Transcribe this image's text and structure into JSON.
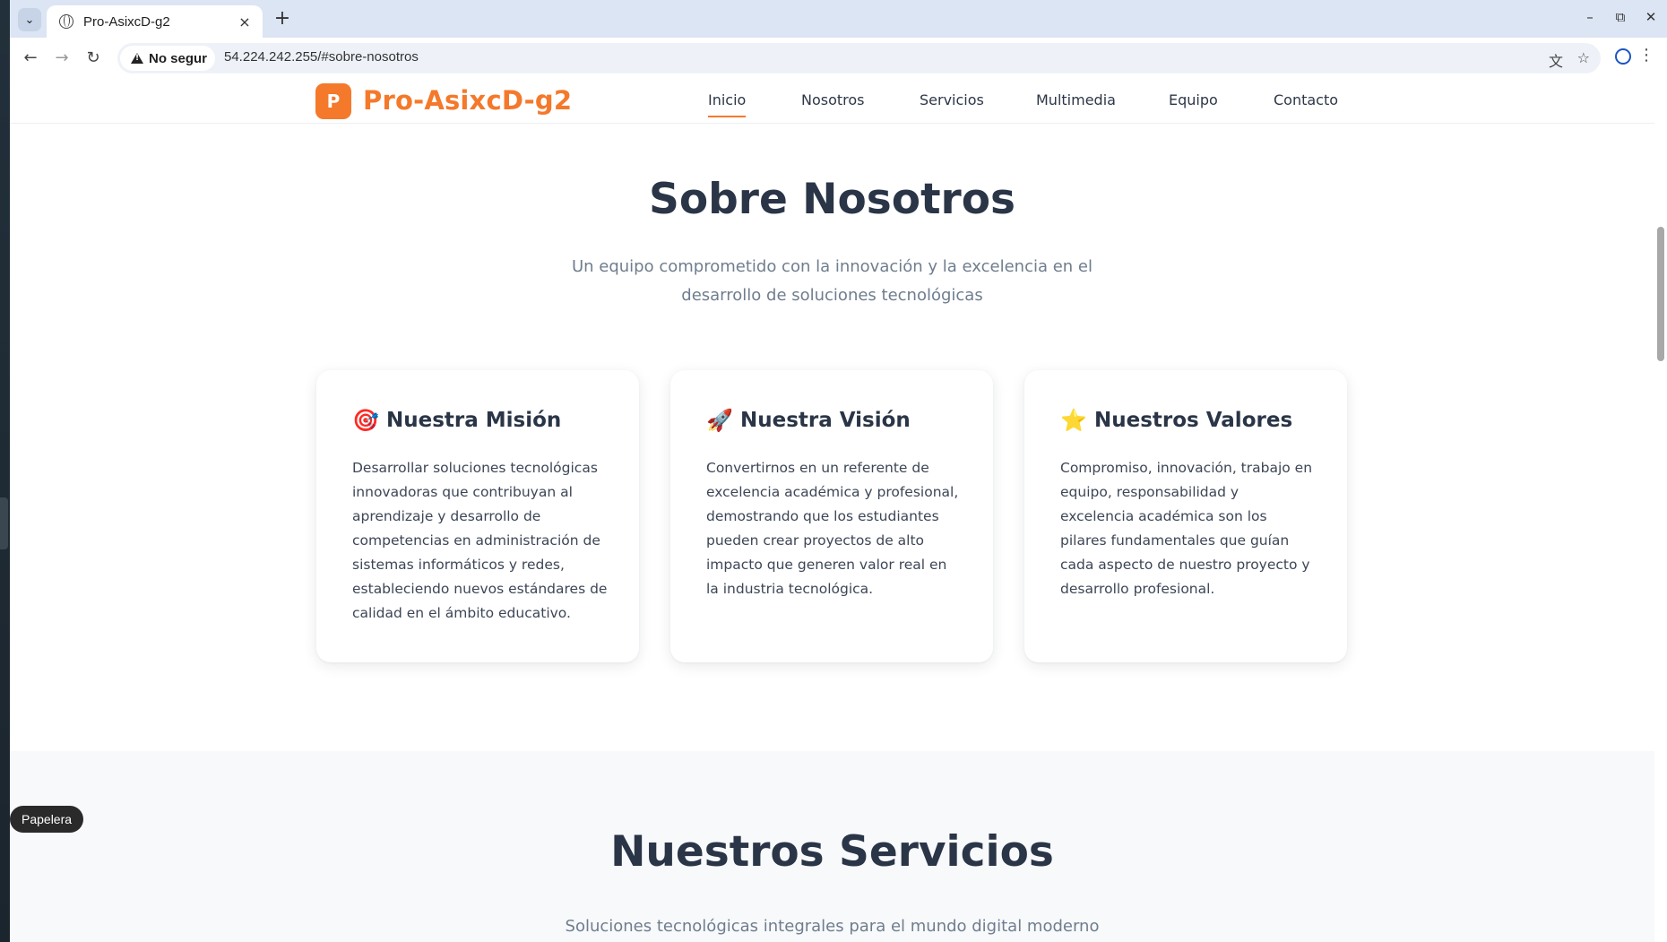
{
  "browser": {
    "tab_title": "Pro-AsixcD-g2",
    "tab_close": "×",
    "new_tab": "+",
    "security_label": "No segur",
    "url": "54.224.242.255/#sobre-nosotros"
  },
  "site": {
    "logo_letter": "P",
    "brand": "Pro-AsixcD-g2",
    "nav": [
      "Inicio",
      "Nosotros",
      "Servicios",
      "Multimedia",
      "Equipo",
      "Contacto"
    ],
    "active_nav": "Inicio"
  },
  "about": {
    "title": "Sobre Nosotros",
    "subtitle_line1": "Un equipo comprometido con la innovación y la excelencia en el",
    "subtitle_line2": "desarrollo de soluciones tecnológicas",
    "cards": [
      {
        "icon": "🎯",
        "title": "Nuestra Misión",
        "text": "Desarrollar soluciones tecnológicas innovadoras que contribuyan al aprendizaje y desarrollo de competencias en administración de sistemas informáticos y redes, estableciendo nuevos estándares de calidad en el ámbito educativo."
      },
      {
        "icon": "🚀",
        "title": "Nuestra Visión",
        "text": "Convertirnos en un referente de excelencia académica y profesional, demostrando que los estudiantes pueden crear proyectos de alto impacto que generen valor real en la industria tecnológica."
      },
      {
        "icon": "⭐",
        "title": "Nuestros Valores",
        "text": "Compromiso, innovación, trabajo en equipo, responsabilidad y excelencia académica son los pilares fundamentales que guían cada aspecto de nuestro proyecto y desarrollo profesional."
      }
    ]
  },
  "services": {
    "title": "Nuestros Servicios",
    "subtitle": "Soluciones tecnológicas integrales para el mundo digital moderno"
  },
  "desktop": {
    "tooltip": "Papelera"
  },
  "colors": {
    "accent": "#f4792b",
    "heading": "#2a3547",
    "muted": "#6f7d8e"
  }
}
